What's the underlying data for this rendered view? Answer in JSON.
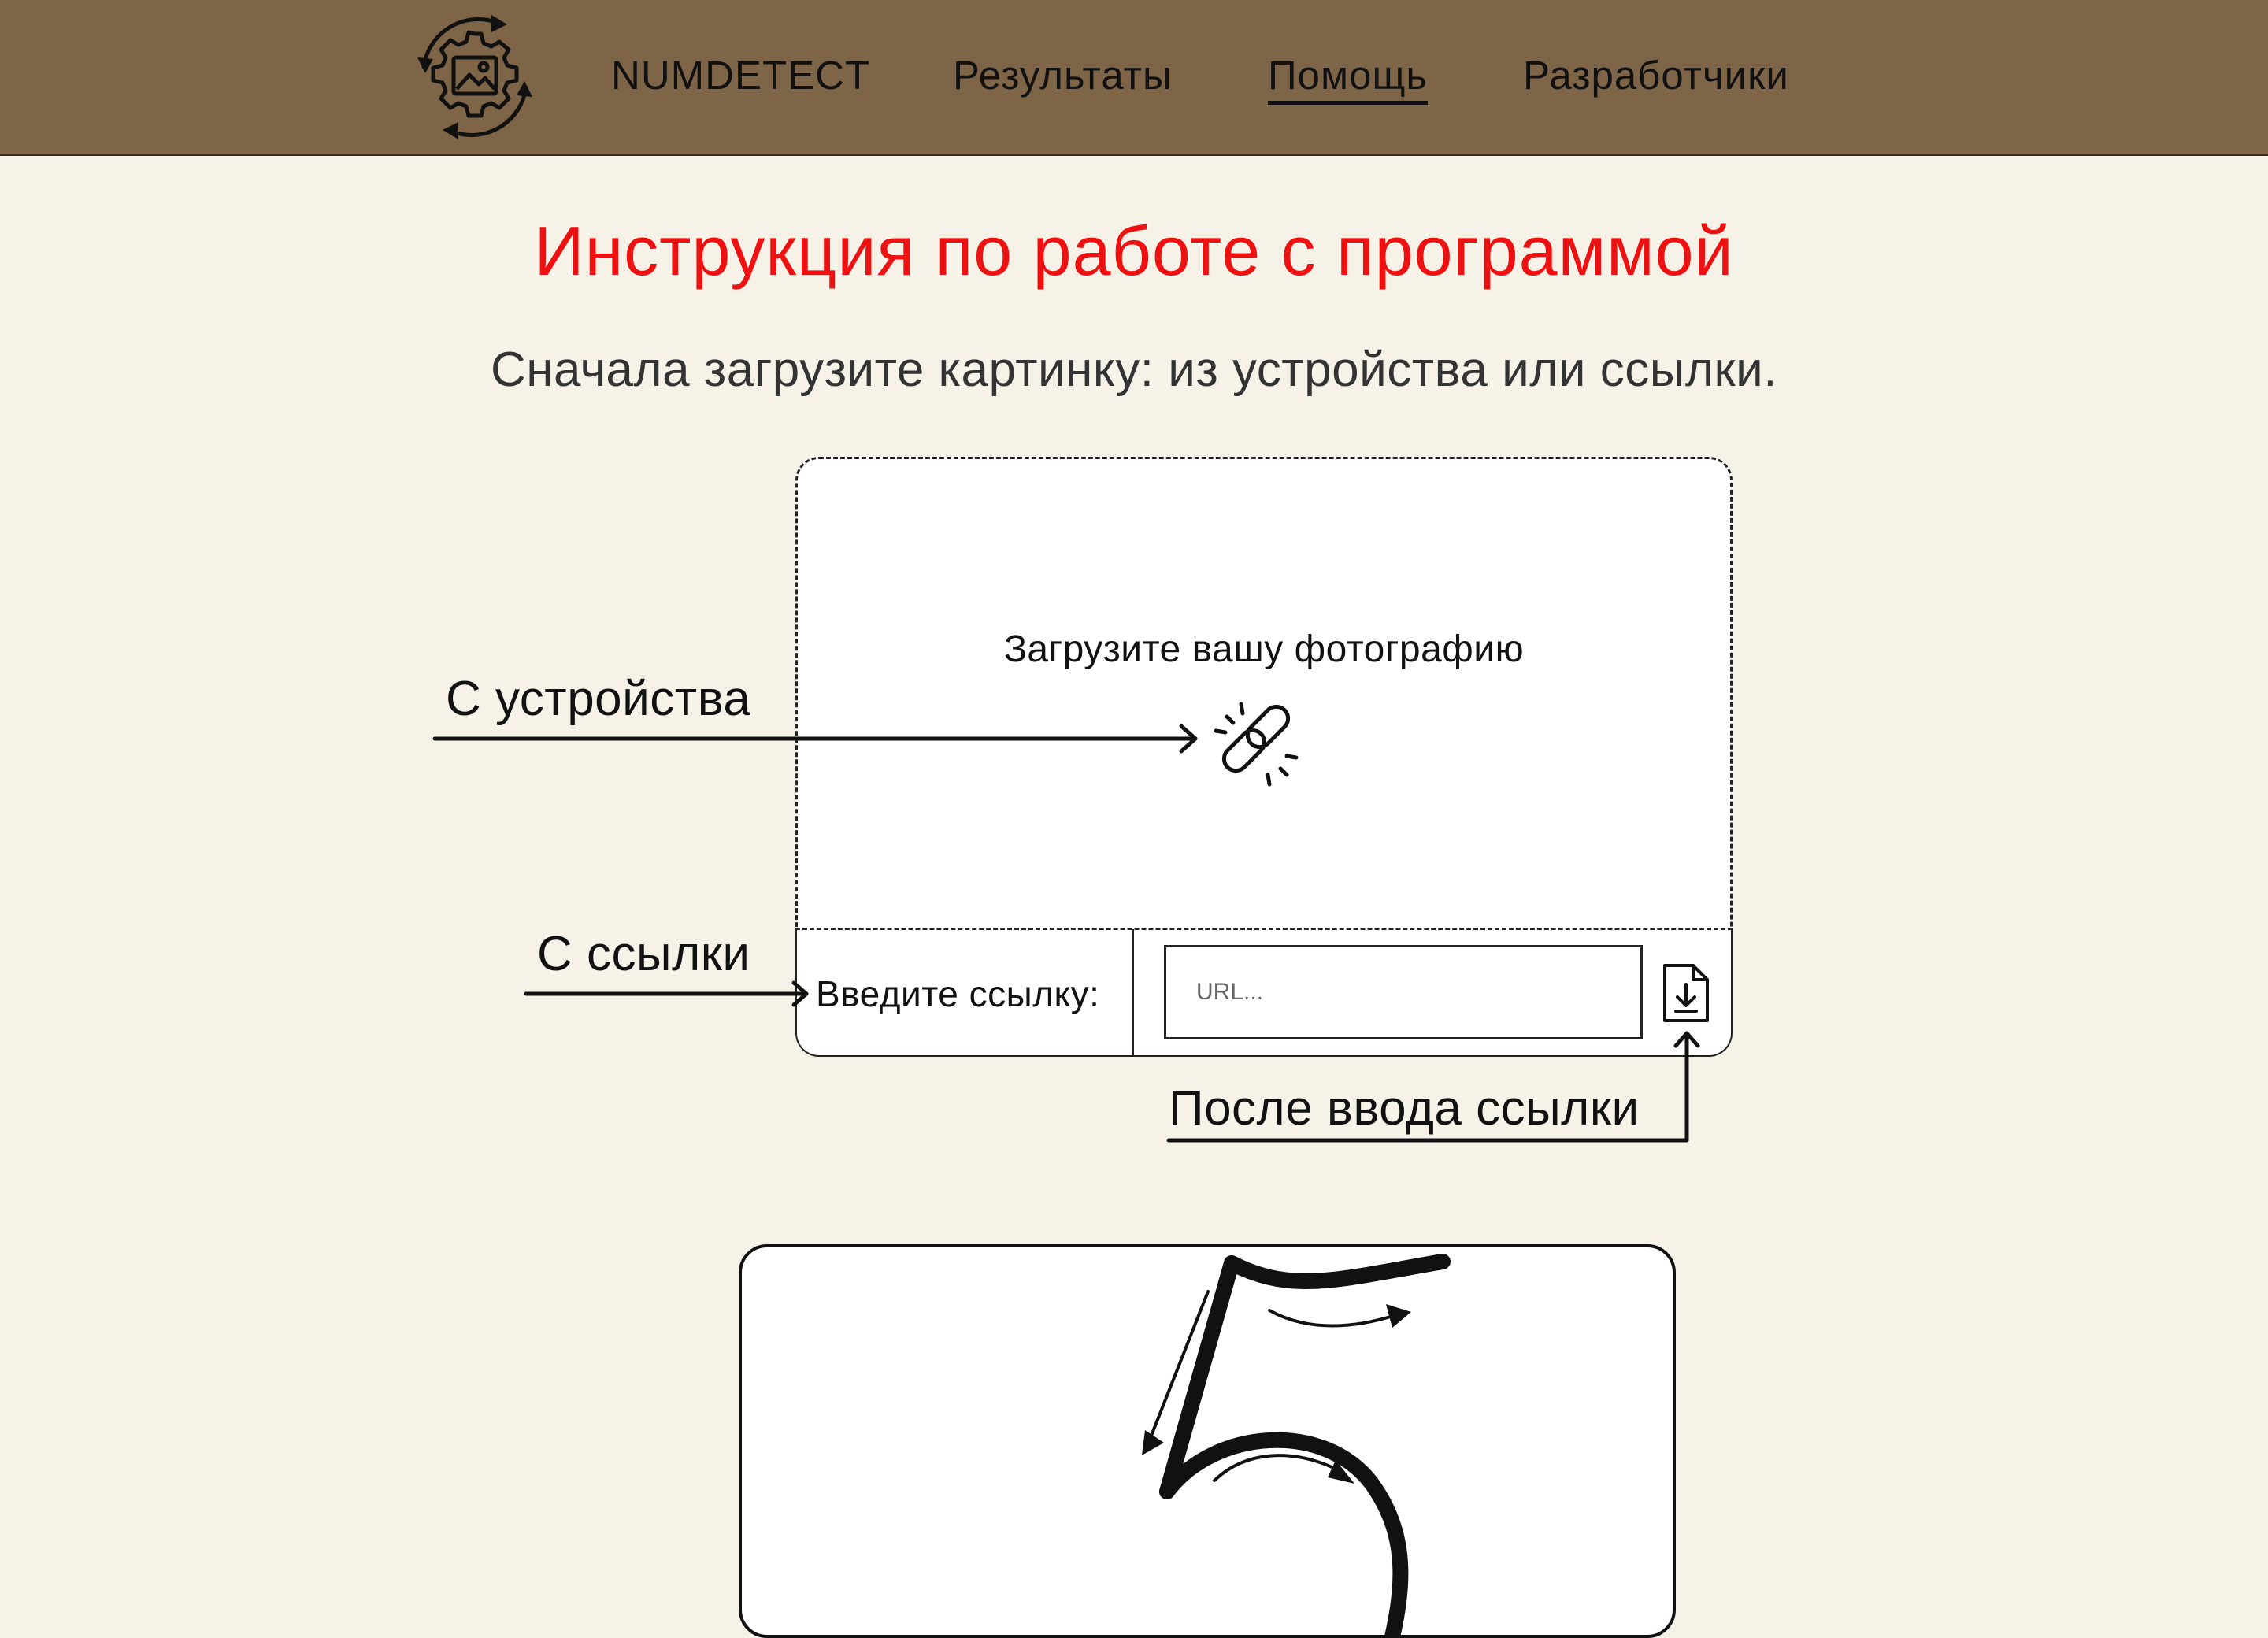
{
  "nav": {
    "brand": "NUMDETECT",
    "results": "Результаты",
    "help": "Помощь",
    "developers": "Разработчики",
    "active": "help"
  },
  "page": {
    "title": "Инструкция по работе с программой",
    "instruction": "Сначала загрузите картинку: из устройства или ссылки."
  },
  "upload": {
    "prompt": "Загрузите вашу фотографию",
    "url_label": "Введите ссылку:",
    "url_placeholder": "URL...",
    "url_value": ""
  },
  "annotations": {
    "from_device": "С устройства",
    "from_link": "С ссылки",
    "after_link": "После ввода ссылки"
  },
  "icons": {
    "logo": "gear-image-refresh-icon",
    "upload": "broken-link-icon",
    "download": "file-download-icon"
  },
  "colors": {
    "header_bg": "#7f6548",
    "page_bg": "#f6f2e7",
    "title": "#ee1111"
  }
}
